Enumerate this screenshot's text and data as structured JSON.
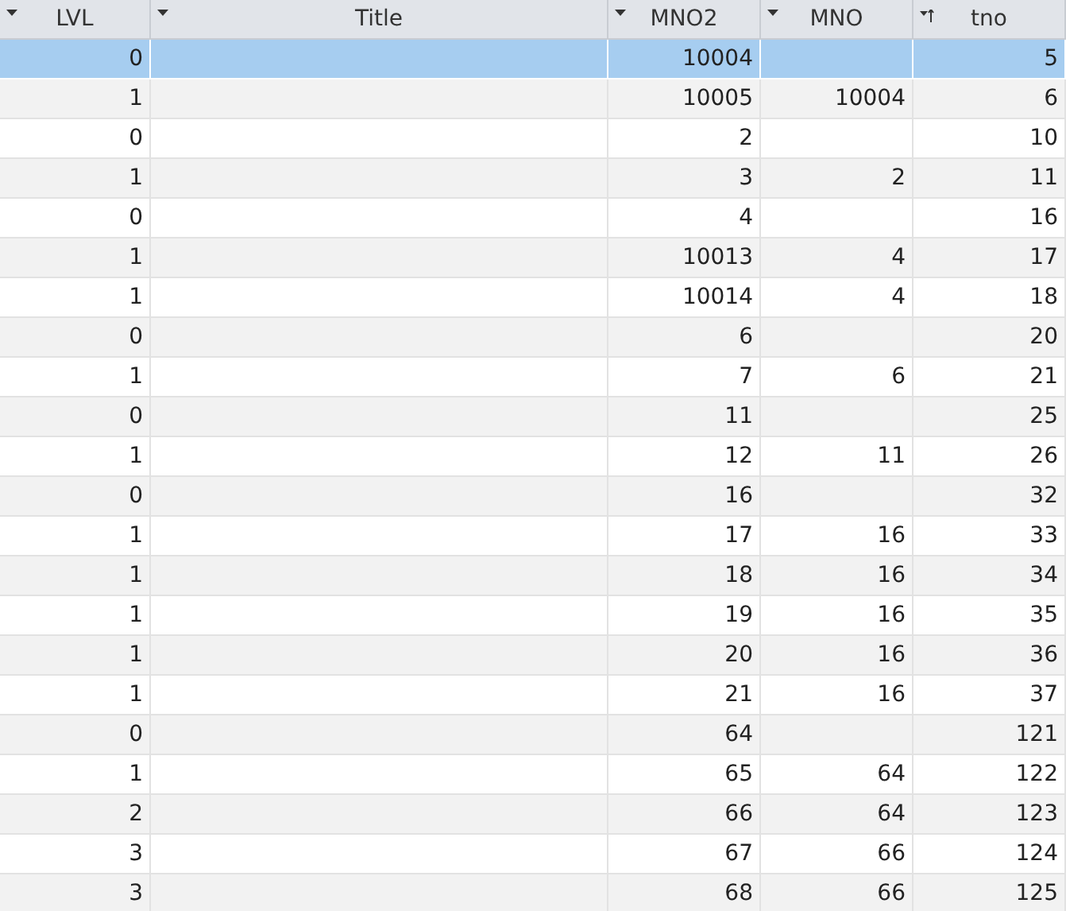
{
  "table": {
    "columns": [
      {
        "label": "LVL",
        "sorted": false
      },
      {
        "label": "Title",
        "sorted": false
      },
      {
        "label": "MNO2",
        "sorted": false
      },
      {
        "label": "MNO",
        "sorted": false
      },
      {
        "label": "tno",
        "sorted": true
      }
    ],
    "rows": [
      {
        "selected": true,
        "lvl": "0",
        "mno2": "10004",
        "tno": "5"
      },
      {
        "selected": false,
        "lvl": "1",
        "mno2": "10005",
        "mno": "10004",
        "tno": "6"
      },
      {
        "selected": false,
        "lvl": "0",
        "mno2": "2",
        "tno": "10"
      },
      {
        "selected": false,
        "lvl": "1",
        "mno2": "3",
        "mno": "2",
        "tno": "11"
      },
      {
        "selected": false,
        "lvl": "0",
        "mno2": "4",
        "tno": "16"
      },
      {
        "selected": false,
        "lvl": "1",
        "mno2": "10013",
        "mno": "4",
        "tno": "17"
      },
      {
        "selected": false,
        "lvl": "1",
        "mno2": "10014",
        "mno": "4",
        "tno": "18"
      },
      {
        "selected": false,
        "lvl": "0",
        "mno2": "6",
        "tno": "20"
      },
      {
        "selected": false,
        "lvl": "1",
        "mno2": "7",
        "mno": "6",
        "tno": "21"
      },
      {
        "selected": false,
        "lvl": "0",
        "mno2": "11",
        "tno": "25"
      },
      {
        "selected": false,
        "lvl": "1",
        "mno2": "12",
        "mno": "11",
        "tno": "26"
      },
      {
        "selected": false,
        "lvl": "0",
        "mno2": "16",
        "tno": "32"
      },
      {
        "selected": false,
        "lvl": "1",
        "mno2": "17",
        "mno": "16",
        "tno": "33"
      },
      {
        "selected": false,
        "lvl": "1",
        "mno2": "18",
        "mno": "16",
        "tno": "34"
      },
      {
        "selected": false,
        "lvl": "1",
        "mno2": "19",
        "mno": "16",
        "tno": "35"
      },
      {
        "selected": false,
        "lvl": "1",
        "mno2": "20",
        "mno": "16",
        "tno": "36"
      },
      {
        "selected": false,
        "lvl": "1",
        "mno2": "21",
        "mno": "16",
        "tno": "37"
      },
      {
        "selected": false,
        "lvl": "0",
        "mno2": "64",
        "tno": "121"
      },
      {
        "selected": false,
        "lvl": "1",
        "mno2": "65",
        "mno": "64",
        "tno": "122"
      },
      {
        "selected": false,
        "lvl": "2",
        "mno2": "66",
        "mno": "64",
        "tno": "123"
      },
      {
        "selected": false,
        "lvl": "3",
        "mno2": "67",
        "mno": "66",
        "tno": "124"
      },
      {
        "selected": false,
        "lvl": "3",
        "mno2": "68",
        "mno": "66",
        "tno": "125"
      }
    ]
  }
}
